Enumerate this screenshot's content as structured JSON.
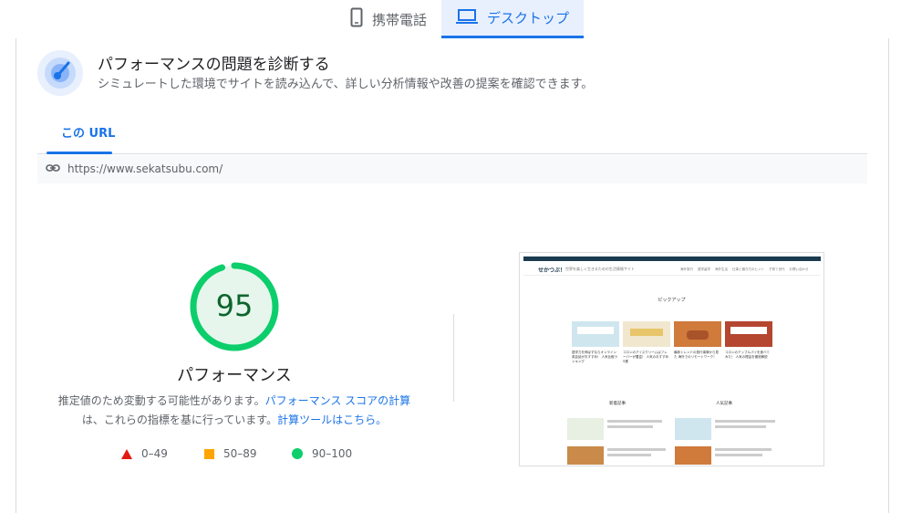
{
  "device_tabs": [
    {
      "label": "携帯電話",
      "icon": "phone-icon",
      "active": false
    },
    {
      "label": "デスクトップ",
      "icon": "laptop-icon",
      "active": true
    }
  ],
  "diagnose": {
    "title": "パフォーマンスの問題を診断する",
    "subtitle": "シミュレートした環境でサイトを読み込んで、詳しい分析情報や改善の提案を確認できます。",
    "icon": "radar-icon"
  },
  "url_tab": {
    "label": "この URL"
  },
  "url_bar": {
    "url": "https://www.sekatsubu.com/",
    "icon": "link-icon"
  },
  "gauge": {
    "score": "95",
    "score_value": 95,
    "label": "パフォーマンス",
    "color": "#0cce6b"
  },
  "description": {
    "part1": "推定値のため変動する可能性があります。",
    "link1": "パフォーマンス スコアの計算",
    "part2": "は、これらの指標を基に行っています。",
    "link2": "計算ツールはこちら。"
  },
  "legend": [
    {
      "range": "0–49",
      "shape": "triangle",
      "color": "#e21b11"
    },
    {
      "range": "50–89",
      "shape": "square",
      "color": "#ffa400"
    },
    {
      "range": "90–100",
      "shape": "circle",
      "color": "#0cce6b"
    }
  ],
  "screenshot": {
    "logo": "せかつぶ！",
    "tagline": "世界を楽しく生きるための生活情報サイト",
    "nav": [
      "海外旅行",
      "語学留学",
      "海外生活",
      "仕事と働き方のヒント",
      "子育て世代",
      "お問い合わせ"
    ],
    "section_title": "ピックアップ",
    "cards": [
      "語学力を伸ばすならオンライン英会話がおすすめ！ 人気比較ランキング",
      "コロンのアイスクリームはフレーバーが豊富！ 人気のおすすめ5選",
      "最新トレンドの旅行事情から見た 海外でのリモートワーク！",
      "コロンのアップルパイを食べてみた！ 人気の理由を徹底解説"
    ],
    "col_left_title": "新着記事",
    "col_right_title": "人気記事"
  }
}
